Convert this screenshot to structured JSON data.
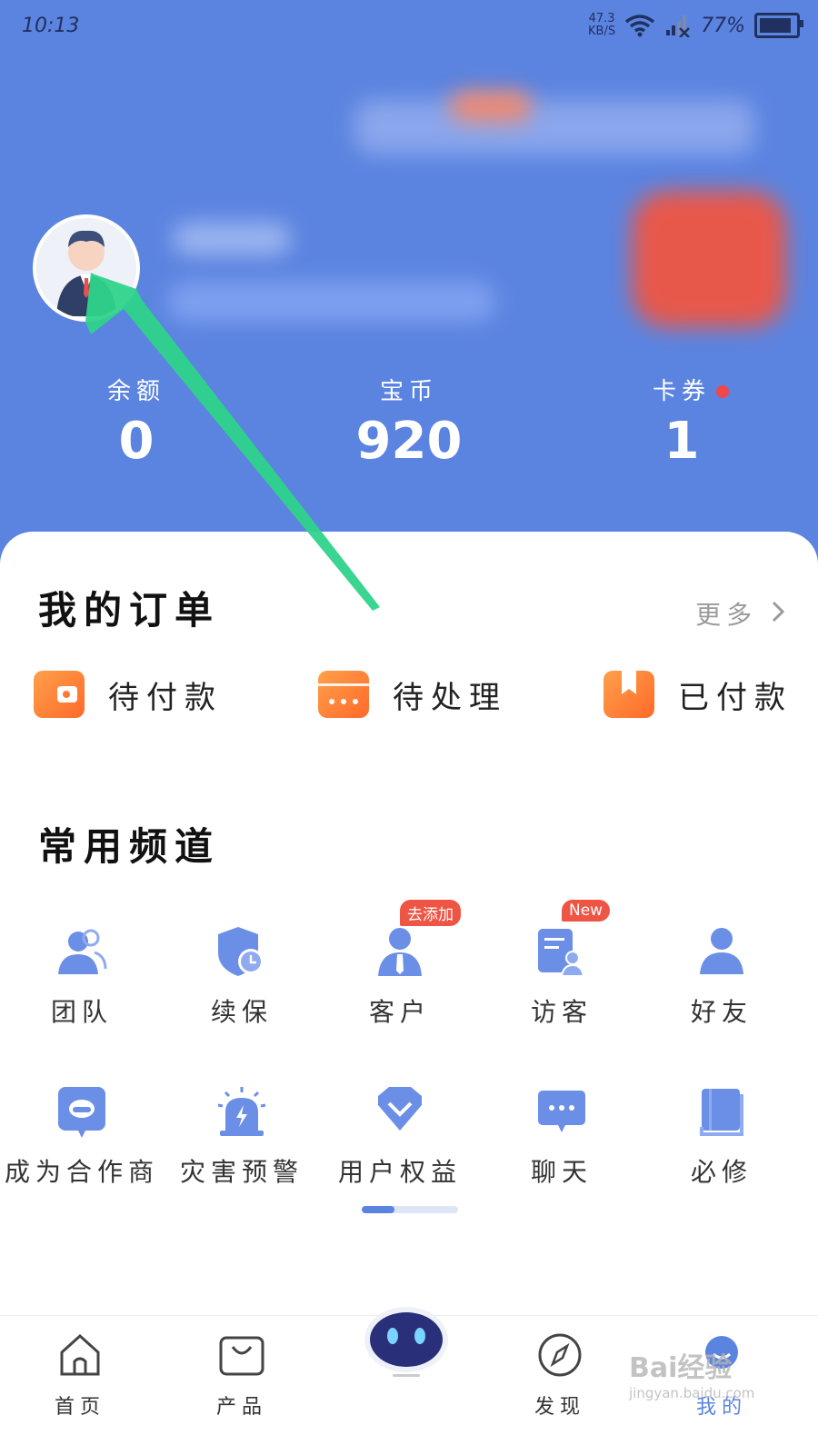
{
  "status_bar": {
    "time": "10:13",
    "net_speed_value": "47.3",
    "net_speed_unit": "KB/S",
    "battery": "77%"
  },
  "stats": [
    {
      "label": "余额",
      "value": "0",
      "has_dot": false
    },
    {
      "label": "宝币",
      "value": "920",
      "has_dot": false
    },
    {
      "label": "卡券",
      "value": "1",
      "has_dot": true
    }
  ],
  "orders": {
    "title": "我的订单",
    "more": "更多",
    "items": [
      {
        "label": "待付款",
        "icon": "wallet-icon"
      },
      {
        "label": "待处理",
        "icon": "card-icon"
      },
      {
        "label": "已付款",
        "icon": "box-icon"
      }
    ]
  },
  "channels": {
    "title": "常用频道",
    "row1": [
      {
        "label": "团队",
        "icon": "team-icon"
      },
      {
        "label": "续保",
        "icon": "shield-clock-icon"
      },
      {
        "label": "客户",
        "icon": "client-icon",
        "badge": "去添加"
      },
      {
        "label": "访客",
        "icon": "visitor-icon",
        "badge": "New"
      },
      {
        "label": "好友",
        "icon": "friend-icon"
      }
    ],
    "row2": [
      {
        "label": "成为合作商",
        "icon": "partner-car-icon"
      },
      {
        "label": "灾害预警",
        "icon": "alarm-icon"
      },
      {
        "label": "用户权益",
        "icon": "diamond-icon"
      },
      {
        "label": "聊天",
        "icon": "chat-icon"
      },
      {
        "label": "必修",
        "icon": "book-icon"
      }
    ]
  },
  "tabbar": {
    "items": [
      {
        "label": "首页",
        "icon": "home-icon"
      },
      {
        "label": "产品",
        "icon": "bag-icon"
      },
      {
        "label": "",
        "icon": "robot-icon"
      },
      {
        "label": "发现",
        "icon": "compass-icon"
      },
      {
        "label": "我的",
        "icon": "profile-icon"
      }
    ]
  },
  "watermark": {
    "brand": "Bai经验",
    "url": "jingyan.baidu.com"
  },
  "colors": {
    "header": "#5b84e0",
    "accent_icon": "#6b8fe6",
    "order_icon": "#ff7a30",
    "arrow": "#2fd38a"
  }
}
